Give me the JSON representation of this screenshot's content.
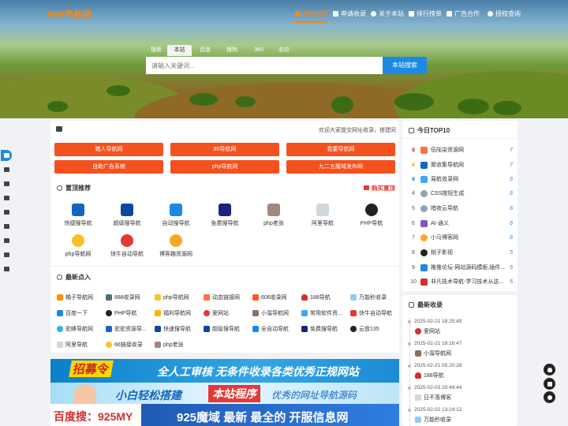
{
  "logo": "PHP导航网",
  "nav": [
    {
      "label": "导航首页",
      "icon": "home-icon"
    },
    {
      "label": "申请收录",
      "icon": "plus-square-icon"
    },
    {
      "label": "关于本站",
      "icon": "info-icon"
    },
    {
      "label": "排行榜单",
      "icon": "bar-chart-icon"
    },
    {
      "label": "广告合作",
      "icon": "megaphone-icon"
    },
    {
      "label": "授权查询",
      "icon": "check-circle-icon"
    }
  ],
  "search": {
    "tabs": [
      "搜索",
      "本站",
      "百度",
      "搜狗",
      "360",
      "必应"
    ],
    "active_tab": "本站",
    "placeholder": "请输入关键词...",
    "button": "本站搜索"
  },
  "notice": "欢迎大家提交网址收录，搭建同",
  "orange_buttons": [
    "猪人导航网",
    "80导航网",
    "我要导航网",
    "自助广告系统",
    "php导航网",
    "九二五魔域发布网"
  ],
  "pinned": {
    "title": "置顶推荐",
    "buy": "购买置顶",
    "items": [
      "快捷搜导航",
      "超级搜导航",
      "自动搜导航",
      "免费搜导航",
      "php老张",
      "阿里导航",
      "PHP导航",
      "php导航网",
      "快牛自动导航",
      "博客趣资源网"
    ]
  },
  "latest_in": {
    "title": "最新点入",
    "items": [
      "橘子导航网",
      "888收录网",
      "php导航网",
      "动态链接网",
      "606收录网",
      "188导航",
      "万能秒收录",
      "百度一下",
      "PHP导航",
      "福利导航网",
      "爱网站",
      "小溜导航网",
      "常用软件资...",
      "快牛自动导航",
      "驼峰导航网",
      "驼驼资源导...",
      "快速搜导航",
      "超级搜导航",
      "全自动导航",
      "免费搜导航",
      "云盘135",
      "阿里导航",
      "66链接收录",
      "php老张"
    ]
  },
  "banners": {
    "b1_tag": "招募令",
    "b1_text": "全人工审核  无条件收录各类优秀正规网站",
    "b2_text1": "小白轻松搭建",
    "b2_text2": "本站程序",
    "b2_text3": "优秀的网址导航源码",
    "b3_left": "百度搜：",
    "b3_code": "925MY",
    "b3_text": "925魔域  最新  最全的  开服信息网"
  },
  "top10": {
    "title": "今日TOP10",
    "items": [
      {
        "rank": "1",
        "name": "伍陆柒资源网",
        "count": "7"
      },
      {
        "rank": "2",
        "name": "聚收集导航网",
        "count": "7"
      },
      {
        "rank": "3",
        "name": "易航收录网",
        "count": "6"
      },
      {
        "rank": "4",
        "name": "CSS按钮生成",
        "count": "6"
      },
      {
        "rank": "5",
        "name": "暗夜云导航",
        "count": "6"
      },
      {
        "rank": "6",
        "name": "AI-通义",
        "count": "6"
      },
      {
        "rank": "7",
        "name": "小马博客网",
        "count": "6"
      },
      {
        "rank": "8",
        "name": "桃子影视",
        "count": "5"
      },
      {
        "rank": "9",
        "name": "推推论坛-网站源码模板,插件...",
        "count": "5"
      },
      {
        "rank": "10",
        "name": "非凡技术导航-学习技术从这...",
        "count": "5"
      }
    ]
  },
  "recent": {
    "title": "最新收录",
    "items": [
      {
        "date": "2025-02-21 18:25:49",
        "name": "爱网站"
      },
      {
        "date": "2025-02-21 18:16:47",
        "name": "小溜导航网"
      },
      {
        "date": "2025-02-21 05:20:28",
        "name": "188导航"
      },
      {
        "date": "2025-02-03 20:49:44",
        "name": "日不落博客"
      },
      {
        "date": "2025-02-02 13:24:12",
        "name": "万能秒收录"
      }
    ]
  },
  "colors": {
    "accent": "#f08a1c",
    "primary": "#1e88e5",
    "orange": "#f4511e"
  }
}
